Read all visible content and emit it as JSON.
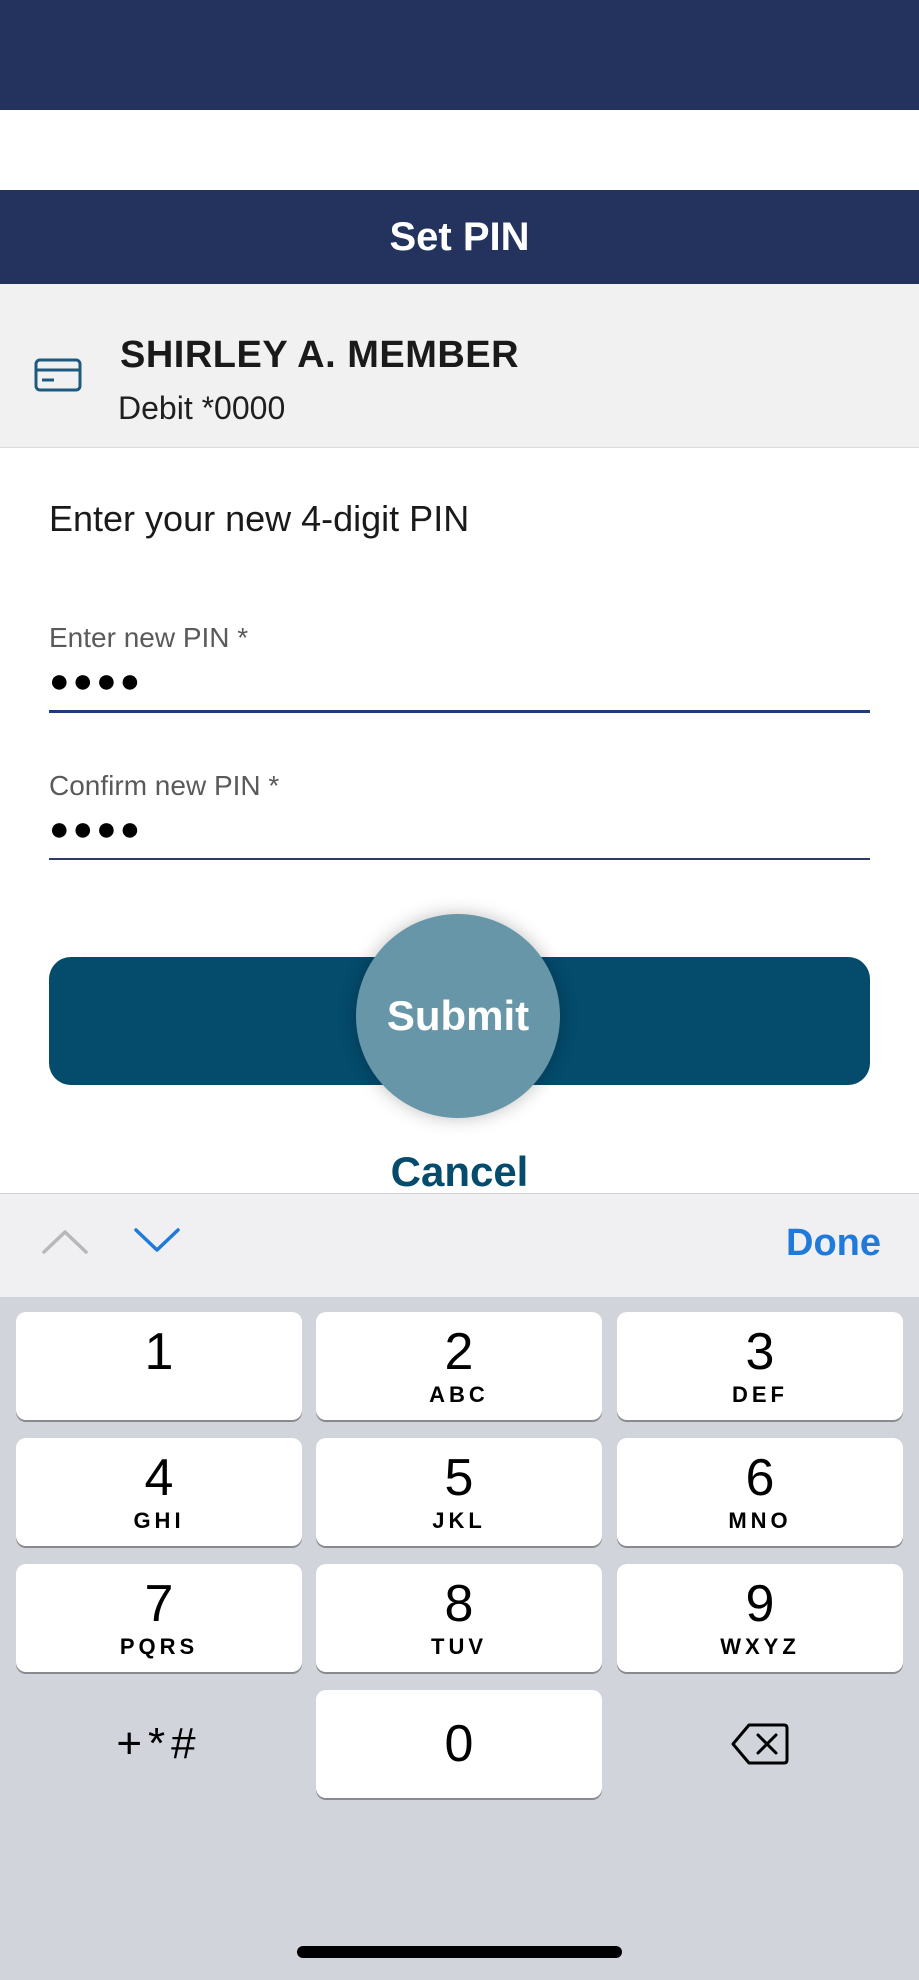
{
  "header": {
    "title": "Set PIN"
  },
  "card": {
    "icon": "credit-card-icon",
    "holder_name": "SHIRLEY A. MEMBER",
    "account": "Debit *0000"
  },
  "form": {
    "instruction": "Enter your new 4-digit PIN",
    "new_pin": {
      "label": "Enter new PIN *",
      "value": "●●●●"
    },
    "confirm_pin": {
      "label": "Confirm new PIN *",
      "value": "●●●●"
    },
    "submit_label": "Submit",
    "cancel_label": "Cancel"
  },
  "keyboard_toolbar": {
    "prev_icon": "chevron-up-icon",
    "next_icon": "chevron-down-icon",
    "done_label": "Done"
  },
  "keypad": {
    "keys": [
      {
        "num": "1",
        "letters": ""
      },
      {
        "num": "2",
        "letters": "ABC"
      },
      {
        "num": "3",
        "letters": "DEF"
      },
      {
        "num": "4",
        "letters": "GHI"
      },
      {
        "num": "5",
        "letters": "JKL"
      },
      {
        "num": "6",
        "letters": "MNO"
      },
      {
        "num": "7",
        "letters": "PQRS"
      },
      {
        "num": "8",
        "letters": "TUV"
      },
      {
        "num": "9",
        "letters": "WXYZ"
      },
      {
        "num": "0",
        "letters": ""
      }
    ],
    "symbols_label": "+*#",
    "delete_icon": "backspace-icon"
  },
  "colors": {
    "navy": "#24325e",
    "teal": "#044b6c",
    "done_blue": "#1f7ad9"
  }
}
